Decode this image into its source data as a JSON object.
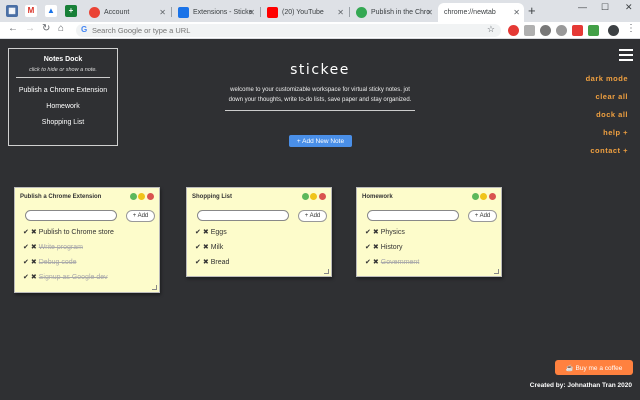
{
  "browser": {
    "tabs": [
      {
        "label": "Account"
      },
      {
        "label": "Extensions - Sticke"
      },
      {
        "label": "(20) YouTube"
      },
      {
        "label": "Publish in the Chro"
      },
      {
        "label": "chrome://newtab"
      }
    ],
    "new_tab": "+",
    "address_placeholder": "Search Google or type a URL",
    "colors": {
      "gmail": "#d93025",
      "drive": "#1a73e8",
      "sheets": "#188038",
      "account": "#ea4335",
      "extensions": "#1a73e8",
      "youtube": "#ff0000",
      "chrome": "#34a853"
    }
  },
  "dock": {
    "title": "Notes Dock",
    "subtitle": "click to hide or show a note.",
    "items": [
      "Publish a Chrome Extension",
      "Homework",
      "Shopping List"
    ]
  },
  "hero": {
    "title": "stickee",
    "description": "welcome to your customizable workspace for virtual sticky notes. jot down your thoughts, write to-do lists, save paper and stay organized.",
    "add_button": "+ Add New Note"
  },
  "menu": {
    "items": [
      "dark mode",
      "clear all",
      "dock all",
      "help +",
      "contact +"
    ],
    "accent": "#f0a040"
  },
  "notes": [
    {
      "title": "Publish a Chrome Extension",
      "add_label": "+ Add",
      "tasks": [
        {
          "text": "Publish to Chrome store",
          "done": false
        },
        {
          "text": "Write program",
          "done": true
        },
        {
          "text": "Debug code",
          "done": true
        },
        {
          "text": "Signup as Google dev",
          "done": true
        }
      ]
    },
    {
      "title": "Shopping List",
      "add_label": "+ Add",
      "tasks": [
        {
          "text": "Eggs",
          "done": false
        },
        {
          "text": "Milk",
          "done": false
        },
        {
          "text": "Bread",
          "done": false
        }
      ]
    },
    {
      "title": "Homework",
      "add_label": "+ Add",
      "tasks": [
        {
          "text": "Physics",
          "done": false
        },
        {
          "text": "History",
          "done": false
        },
        {
          "text": "Government",
          "done": true
        }
      ]
    }
  ],
  "note_dots": [
    "#5cb85c",
    "#f0c419",
    "#d9534f"
  ],
  "footer": {
    "coffee": "Buy me a coffee",
    "credit": "Created by: Johnathan Tran 2020"
  }
}
